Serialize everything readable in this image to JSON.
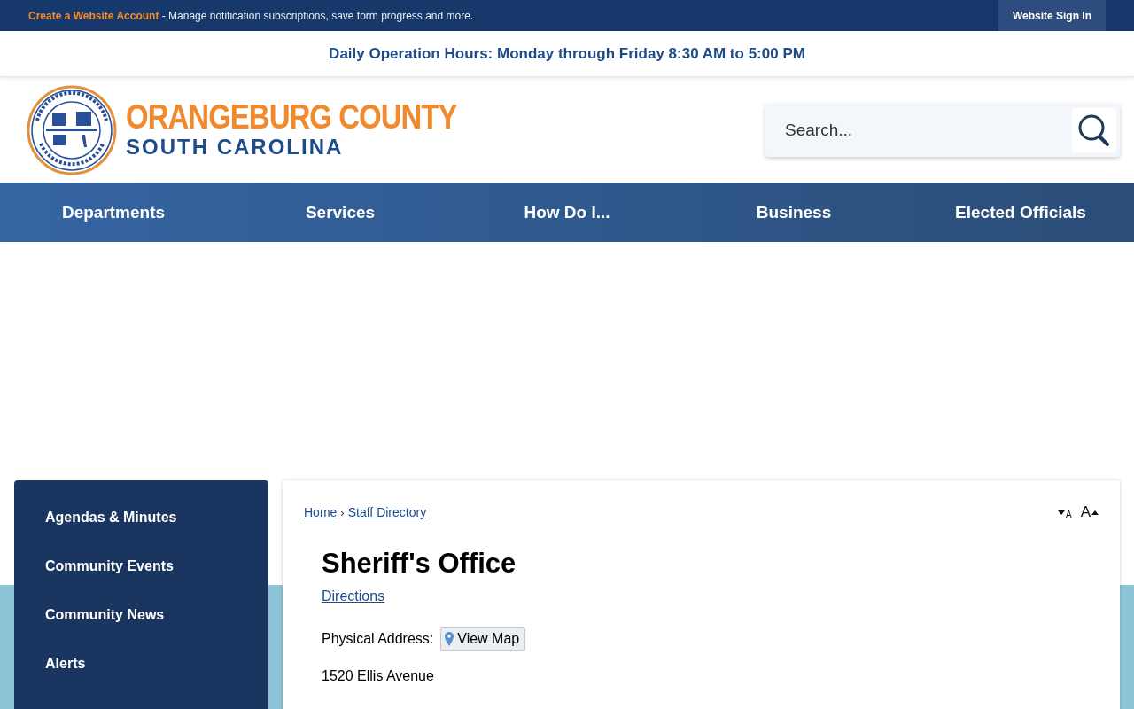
{
  "top_bar": {
    "link": "Create a Website Account",
    "message": " - Manage notification subscriptions, save form progress and more.",
    "sign_in": "Website Sign In"
  },
  "hours_banner": "Daily Operation Hours: Monday through Friday 8:30 AM to 5:00 PM",
  "logo": {
    "line1": "ORANGEBURG COUNTY",
    "line2": "SOUTH CAROLINA"
  },
  "search": {
    "placeholder": "Search..."
  },
  "nav": [
    "Departments",
    "Services",
    "How Do I...",
    "Business",
    "Elected Officials"
  ],
  "sidebar": {
    "items": [
      "Agendas & Minutes",
      "Community Events",
      "Community News",
      "Alerts"
    ]
  },
  "content": {
    "breadcrumb": [
      {
        "label": "Home"
      },
      {
        "label": "Staff Directory"
      }
    ],
    "separator": "›",
    "font_controls": [
      {
        "kind": "decrease",
        "label": "A"
      },
      {
        "kind": "increase",
        "label": "A"
      }
    ],
    "title": "Sheriff's Office",
    "directions": "Directions",
    "address_label": "Physical Address:",
    "map_button": "View Map",
    "address_line": "1520 Ellis Avenue"
  }
}
